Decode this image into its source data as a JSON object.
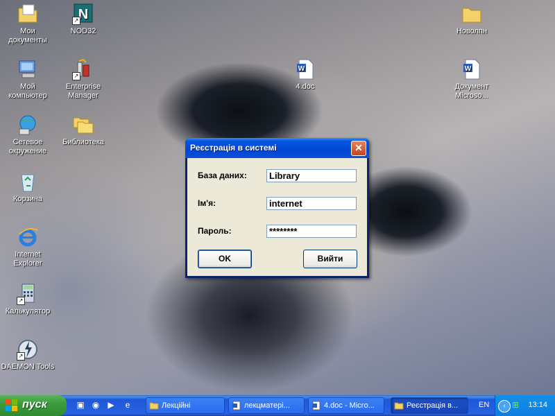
{
  "desktop": {
    "icons_left": [
      {
        "name": "my-documents",
        "label": "Мои документы"
      },
      {
        "name": "my-computer",
        "label": "Мой компьютер"
      },
      {
        "name": "network",
        "label": "Сетевое окружение"
      },
      {
        "name": "recycle-bin",
        "label": "Корзина"
      },
      {
        "name": "internet-explorer",
        "label": "Internet Explorer"
      },
      {
        "name": "calculator",
        "label": "Калькулятор"
      },
      {
        "name": "daemon-tools",
        "label": "DAEMON Tools"
      }
    ],
    "icons_col2": [
      {
        "name": "nod32",
        "label": "NOD32"
      },
      {
        "name": "enterprise-manager",
        "label": "Enterprise Manager"
      },
      {
        "name": "library",
        "label": "Библиотека"
      }
    ],
    "doc_icon": {
      "label": "4.doc"
    },
    "novolpn_icon": {
      "label": "Новолпн"
    },
    "word_doc_icon": {
      "label": "Документ Microso..."
    }
  },
  "dialog": {
    "title": "Реєстрація в системі",
    "fields": {
      "database_label": "База даних:",
      "database_value": "Library",
      "name_label": "Ім'я:",
      "name_value": "internet",
      "password_label": "Пароль:",
      "password_value": "********"
    },
    "ok_label": "OK",
    "exit_label": "Вийти"
  },
  "taskbar": {
    "start_label": "пуск",
    "tasks": [
      {
        "label": "Лекційні"
      },
      {
        "label": "лекцматері..."
      },
      {
        "label": "4.doc - Micro..."
      },
      {
        "label": "Реєстрація в..."
      }
    ],
    "language": "EN",
    "clock": "13:14"
  },
  "colors": {
    "titlebar": "#0046d5",
    "taskbar": "#2663e0",
    "start": "#3c9c3e",
    "dialog_body": "#ece9d8"
  }
}
